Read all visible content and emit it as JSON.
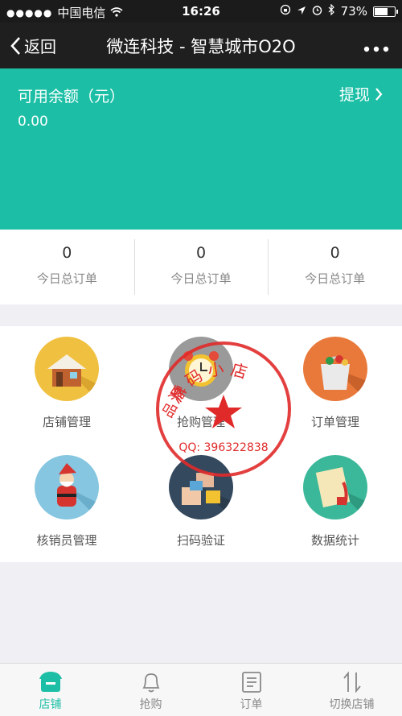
{
  "status": {
    "carrier": "中国电信",
    "time": "16:26",
    "battery": "73%",
    "battery_level": 0.73
  },
  "nav": {
    "back_label": "返回",
    "title": "微连科技 - 智慧城市O2O"
  },
  "balance": {
    "label": "可用余额（元）",
    "amount": "0.00",
    "withdraw_label": "提现"
  },
  "stats": [
    {
      "value": "0",
      "label": "今日总订单"
    },
    {
      "value": "0",
      "label": "今日总订单"
    },
    {
      "value": "0",
      "label": "今日总订单"
    }
  ],
  "menu": [
    {
      "label": "店铺管理",
      "icon": "house-icon",
      "color": "#f0c040"
    },
    {
      "label": "抢购管理",
      "icon": "alarm-clock-icon",
      "color": "#9a9a9a"
    },
    {
      "label": "订单管理",
      "icon": "shopping-bag-icon",
      "color": "#e8793a"
    },
    {
      "label": "核销员管理",
      "icon": "santa-icon",
      "color": "#86c6e0"
    },
    {
      "label": "扫码验证",
      "icon": "boxes-icon",
      "color": "#34495e"
    },
    {
      "label": "数据统计",
      "icon": "scroll-icon",
      "color": "#3bb89a"
    }
  ],
  "stamp": {
    "arc_text": "源 码 小 店",
    "left_chars": "品 牌",
    "qq": "QQ: 396322838",
    "color": "#e02a2a"
  },
  "tabs": [
    {
      "label": "店铺",
      "icon": "store-icon",
      "active": true
    },
    {
      "label": "抢购",
      "icon": "bell-icon",
      "active": false
    },
    {
      "label": "订单",
      "icon": "order-list-icon",
      "active": false
    },
    {
      "label": "切换店铺",
      "icon": "switch-arrows-icon",
      "active": false
    }
  ],
  "colors": {
    "accent": "#1cbfa6",
    "navbar": "#1f1f1f"
  }
}
